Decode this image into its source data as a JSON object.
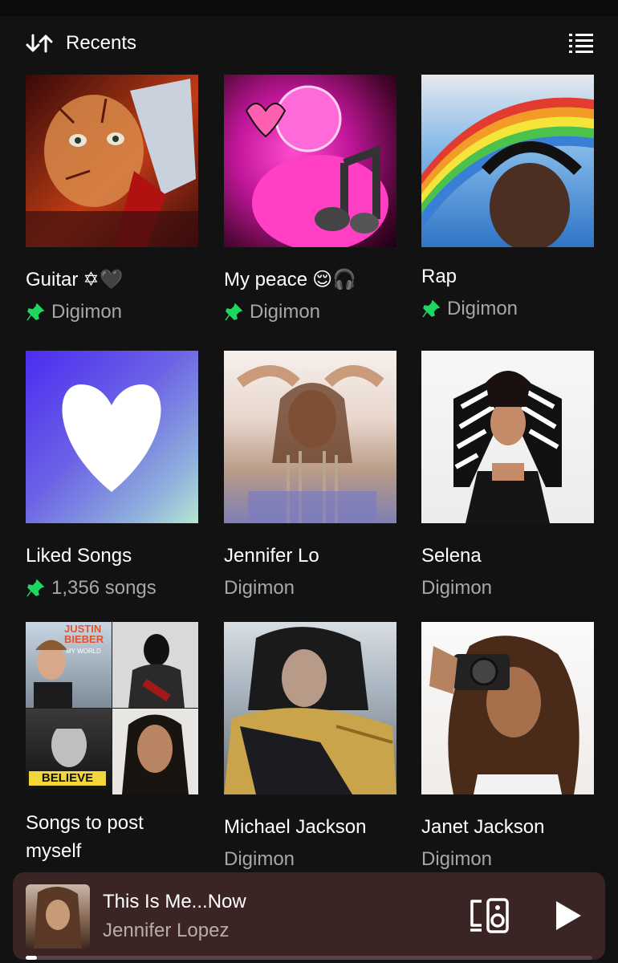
{
  "header": {
    "sort_label": "Recents",
    "sort_icon": "sort-arrows-icon",
    "view_icon": "list-view-icon"
  },
  "items": [
    {
      "title": "Guitar",
      "emoji": "✡🖤",
      "subtitle": "Digimon",
      "pinned": true
    },
    {
      "title": "My peace",
      "emoji": "😌🎧",
      "subtitle": "Digimon",
      "pinned": true
    },
    {
      "title": "Rap",
      "emoji": "",
      "subtitle": "Digimon",
      "pinned": true
    },
    {
      "title": "Liked Songs",
      "emoji": "",
      "subtitle": "1,356 songs",
      "pinned": true
    },
    {
      "title": "Jennifer Lo",
      "emoji": "",
      "subtitle": "Digimon",
      "pinned": false
    },
    {
      "title": "Selena",
      "emoji": "",
      "subtitle": "Digimon",
      "pinned": false
    },
    {
      "title": "Songs to post myself",
      "emoji": "",
      "subtitle": "",
      "pinned": false
    },
    {
      "title": "Michael Jackson",
      "emoji": "",
      "subtitle": "Digimon",
      "pinned": false
    },
    {
      "title": "Janet Jackson",
      "emoji": "",
      "subtitle": "Digimon",
      "pinned": false
    }
  ],
  "mosaic_text": {
    "top_left": "JUSTIN BIEBER",
    "top_left_sub": "MY WORLD",
    "bottom_left": "BELIEVE"
  },
  "now_playing": {
    "title": "This Is Me...Now",
    "artist": "Jennifer Lopez",
    "progress": 0.02,
    "device_icon": "connect-device-icon",
    "play_icon": "play-icon"
  },
  "colors": {
    "background": "#121212",
    "pin": "#1ed760",
    "subtitle": "#a7a7a7",
    "player_bg": "#3a2524"
  }
}
